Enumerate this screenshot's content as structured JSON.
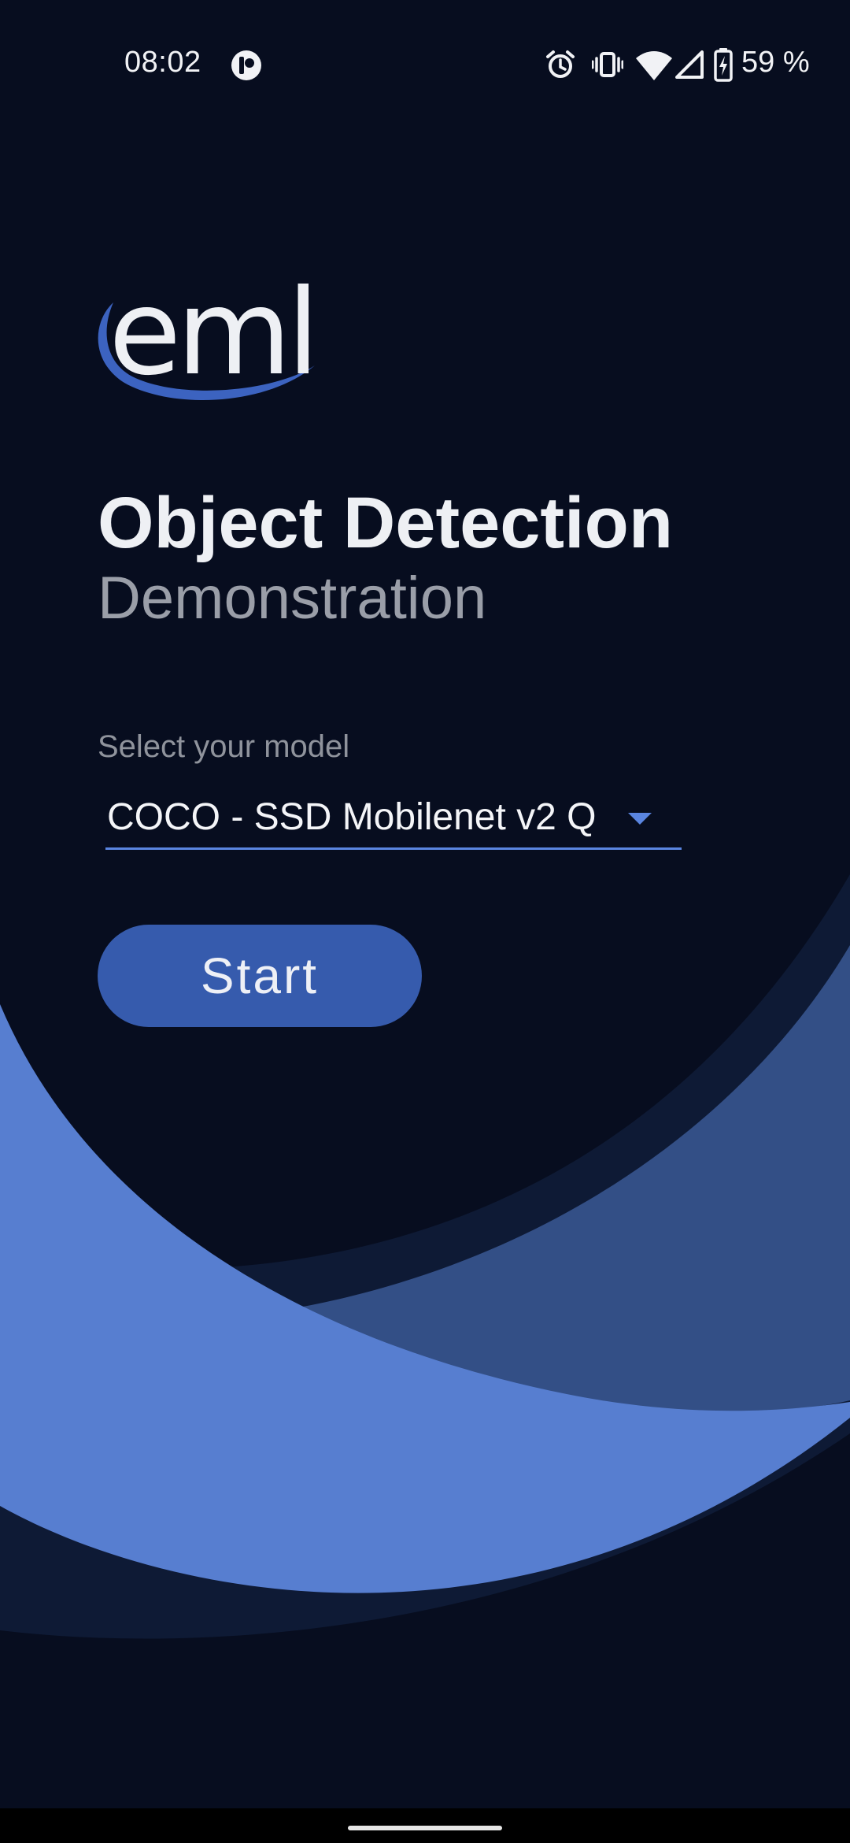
{
  "status_bar": {
    "time": "08:02",
    "battery_text": "59 %",
    "icons": [
      "app-notification-icon",
      "alarm-icon",
      "vibrate-icon",
      "wifi-icon",
      "cellular-signal-icon",
      "battery-charging-icon"
    ]
  },
  "logo": {
    "text": "eml"
  },
  "header": {
    "title": "Object Detection",
    "subtitle": "Demonstration"
  },
  "model_select": {
    "label": "Select your model",
    "selected_value": "COCO - SSD Mobilenet v2 Q"
  },
  "actions": {
    "start_label": "Start"
  },
  "colors": {
    "background": "#070d1f",
    "accent": "#5a85e0",
    "button": "#365bad",
    "wave_light": "#577ed0",
    "wave_mid": "#334f86",
    "wave_dark": "#0e1a35"
  }
}
